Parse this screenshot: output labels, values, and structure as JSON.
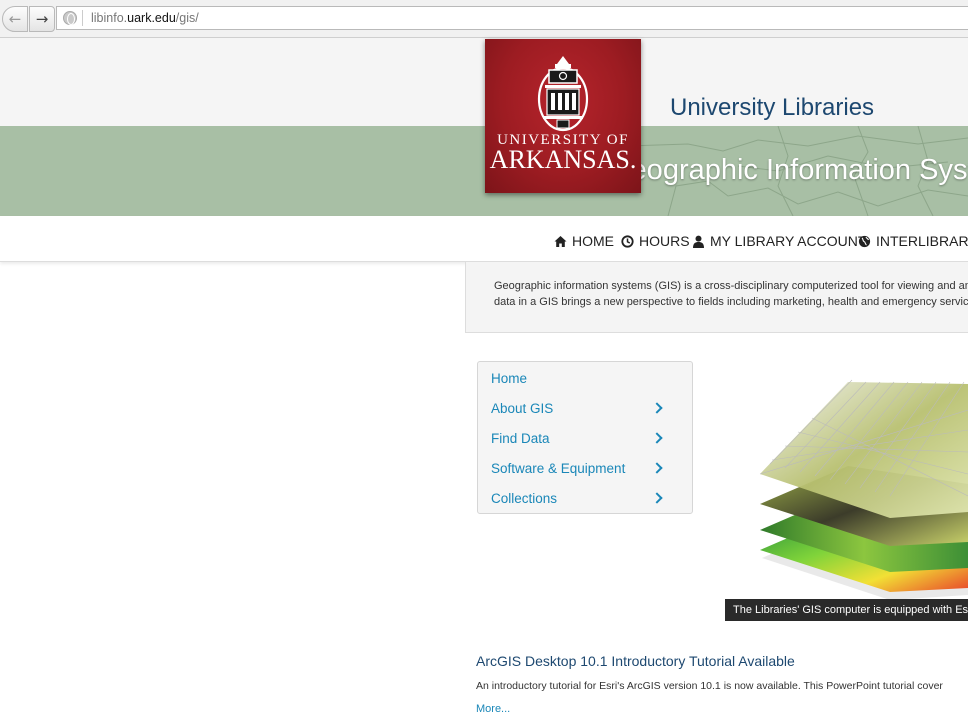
{
  "browser": {
    "url_prefix": "libinfo.",
    "url_host": "uark.edu",
    "url_path": "/gis/"
  },
  "header": {
    "site_name": "University Libraries",
    "banner_title": "Geographic Information Systems & Ma",
    "logo": {
      "line1": "UNIVERSITY OF",
      "line2": "ARKANSAS."
    }
  },
  "mainnav": {
    "items": [
      {
        "label": "HOME",
        "icon": "home-icon"
      },
      {
        "label": "HOURS",
        "icon": "clock-icon"
      },
      {
        "label": "MY LIBRARY ACCOUNT",
        "icon": "user-icon"
      },
      {
        "label": "INTERLIBRARY",
        "icon": "globe-icon"
      }
    ]
  },
  "intro": {
    "line1": "Geographic information systems (GIS) is a cross-disciplinary computerized tool for viewing and ana",
    "line2": "data in a GIS brings a new perspective to fields including marketing, health and emergency services"
  },
  "sidemenu": {
    "items": [
      {
        "label": "Home"
      },
      {
        "label": "About GIS"
      },
      {
        "label": "Find Data"
      },
      {
        "label": "Software & Equipment"
      },
      {
        "label": "Collections"
      }
    ]
  },
  "image": {
    "caption": "The Libraries' GIS computer is equipped with Esri"
  },
  "news": {
    "title": "ArcGIS Desktop 10.1 Introductory Tutorial Available",
    "body": "An introductory tutorial for Esri's ArcGIS version 10.1 is now available. This PowerPoint tutorial cover",
    "more": "More..."
  },
  "colors": {
    "brand_red": "#9d1c22",
    "banner_green": "#a8bfa5",
    "link_blue": "#1a87b8",
    "heading_navy": "#1d4870"
  }
}
